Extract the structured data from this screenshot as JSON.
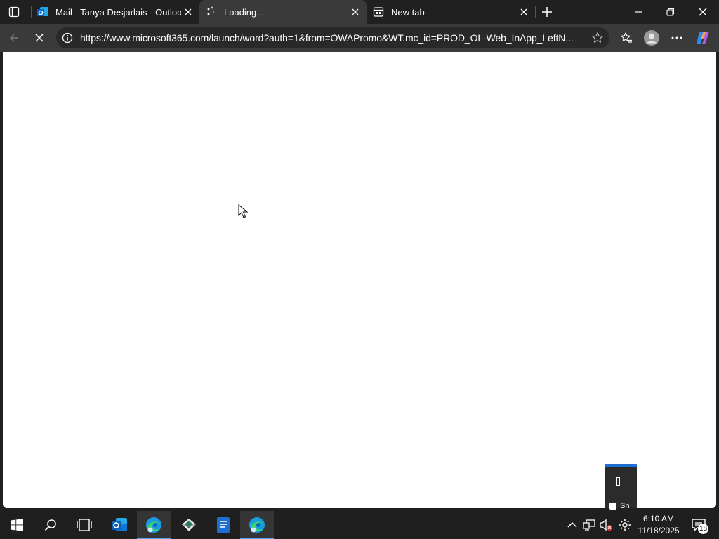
{
  "browser": {
    "tabs": [
      {
        "title": "Mail - Tanya Desjarlais - Outlook",
        "icon": "outlook-icon",
        "active": false
      },
      {
        "title": "Loading...",
        "icon": "loading-icon",
        "active": true
      },
      {
        "title": "New tab",
        "icon": "newtab-page-icon",
        "active": false
      }
    ],
    "address_bar": {
      "url": "https://www.microsoft365.com/launch/word?auth=1&from=OWAPromo&WT.mc_id=PROD_OL-Web_InApp_LeftN..."
    }
  },
  "snip_overlay": {
    "label": "Sn"
  },
  "taskbar": {
    "apps": [
      "start",
      "search",
      "task-view",
      "outlook",
      "edge",
      "app",
      "word",
      "edge-dev"
    ],
    "clock": {
      "time": "6:10 AM",
      "date": "11/18/2025"
    },
    "notification_count": "18"
  },
  "colors": {
    "accent": "#1f6fd1",
    "tab_active": "#3a3a3a",
    "tab_strip": "#202020",
    "taskbar": "#1f1f1f"
  }
}
